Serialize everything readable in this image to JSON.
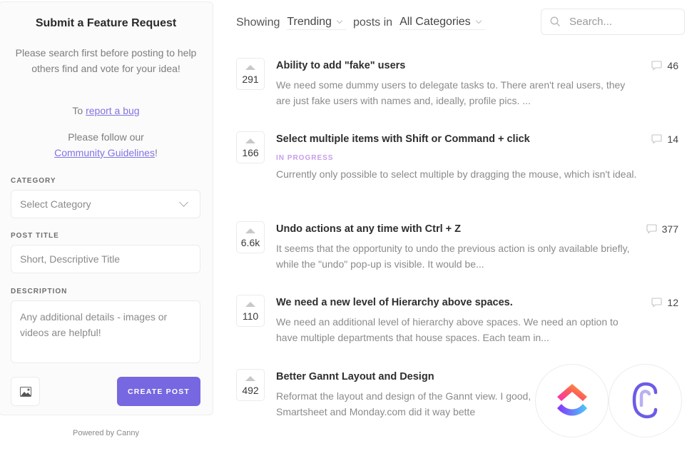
{
  "sidebar": {
    "title": "Submit a Feature Request",
    "intro": "Please search first before posting to help others find and vote for your idea!",
    "bug_prefix": "To ",
    "bug_link": "report a bug",
    "guidelines_prefix": "Please follow our",
    "guidelines_link": "Community Guidelines",
    "guidelines_suffix": "!",
    "form": {
      "category_label": "CATEGORY",
      "category_value": "Select Category",
      "title_label": "POST TITLE",
      "title_placeholder": "Short, Descriptive Title",
      "description_label": "DESCRIPTION",
      "description_placeholder": "Any additional details - images or videos are helpful!",
      "image_button_icon": "image-icon",
      "submit_label": "CREATE POST"
    },
    "powered_by": "Powered by Canny"
  },
  "header": {
    "showing": "Showing",
    "sort_value": "Trending",
    "posts_in": "posts in",
    "category_value": "All Categories",
    "search_placeholder": "Search..."
  },
  "posts": [
    {
      "votes": "291",
      "title": "Ability to add \"fake\" users",
      "status": "",
      "description": "We need some dummy users to delegate tasks to. There aren't real users, they are just fake users with names and, ideally, profile pics. ...",
      "comments": "46"
    },
    {
      "votes": "166",
      "title": "Select multiple items with Shift or Command + click",
      "status": "IN PROGRESS",
      "description": "Currently only possible to select multiple by dragging the mouse, which isn't ideal.",
      "comments": "14"
    },
    {
      "votes": "6.6k",
      "title": "Undo actions at any time with Ctrl + Z",
      "status": "",
      "description": "It seems that the opportunity to undo the previous action is only available briefly, while the \"undo\" pop-up is visible. It would be...",
      "comments": "377"
    },
    {
      "votes": "110",
      "title": "We need a new level of Hierarchy above spaces.",
      "status": "",
      "description": "We need an additional level of hierarchy above spaces. We need an option to have multiple departments that house spaces. Each team in...",
      "comments": "12"
    },
    {
      "votes": "492",
      "title": "Better Gannt Layout and Design",
      "status": "",
      "description": "Reformat the layout and design of the Gannt view. I good, Smartsheet and Monday.com did it way bette",
      "comments": ""
    }
  ],
  "logos": [
    "clickup-logo",
    "canny-logo"
  ],
  "colors": {
    "accent": "#7767e0",
    "link": "#7f74e4",
    "status_in_progress": "#c79de8"
  }
}
